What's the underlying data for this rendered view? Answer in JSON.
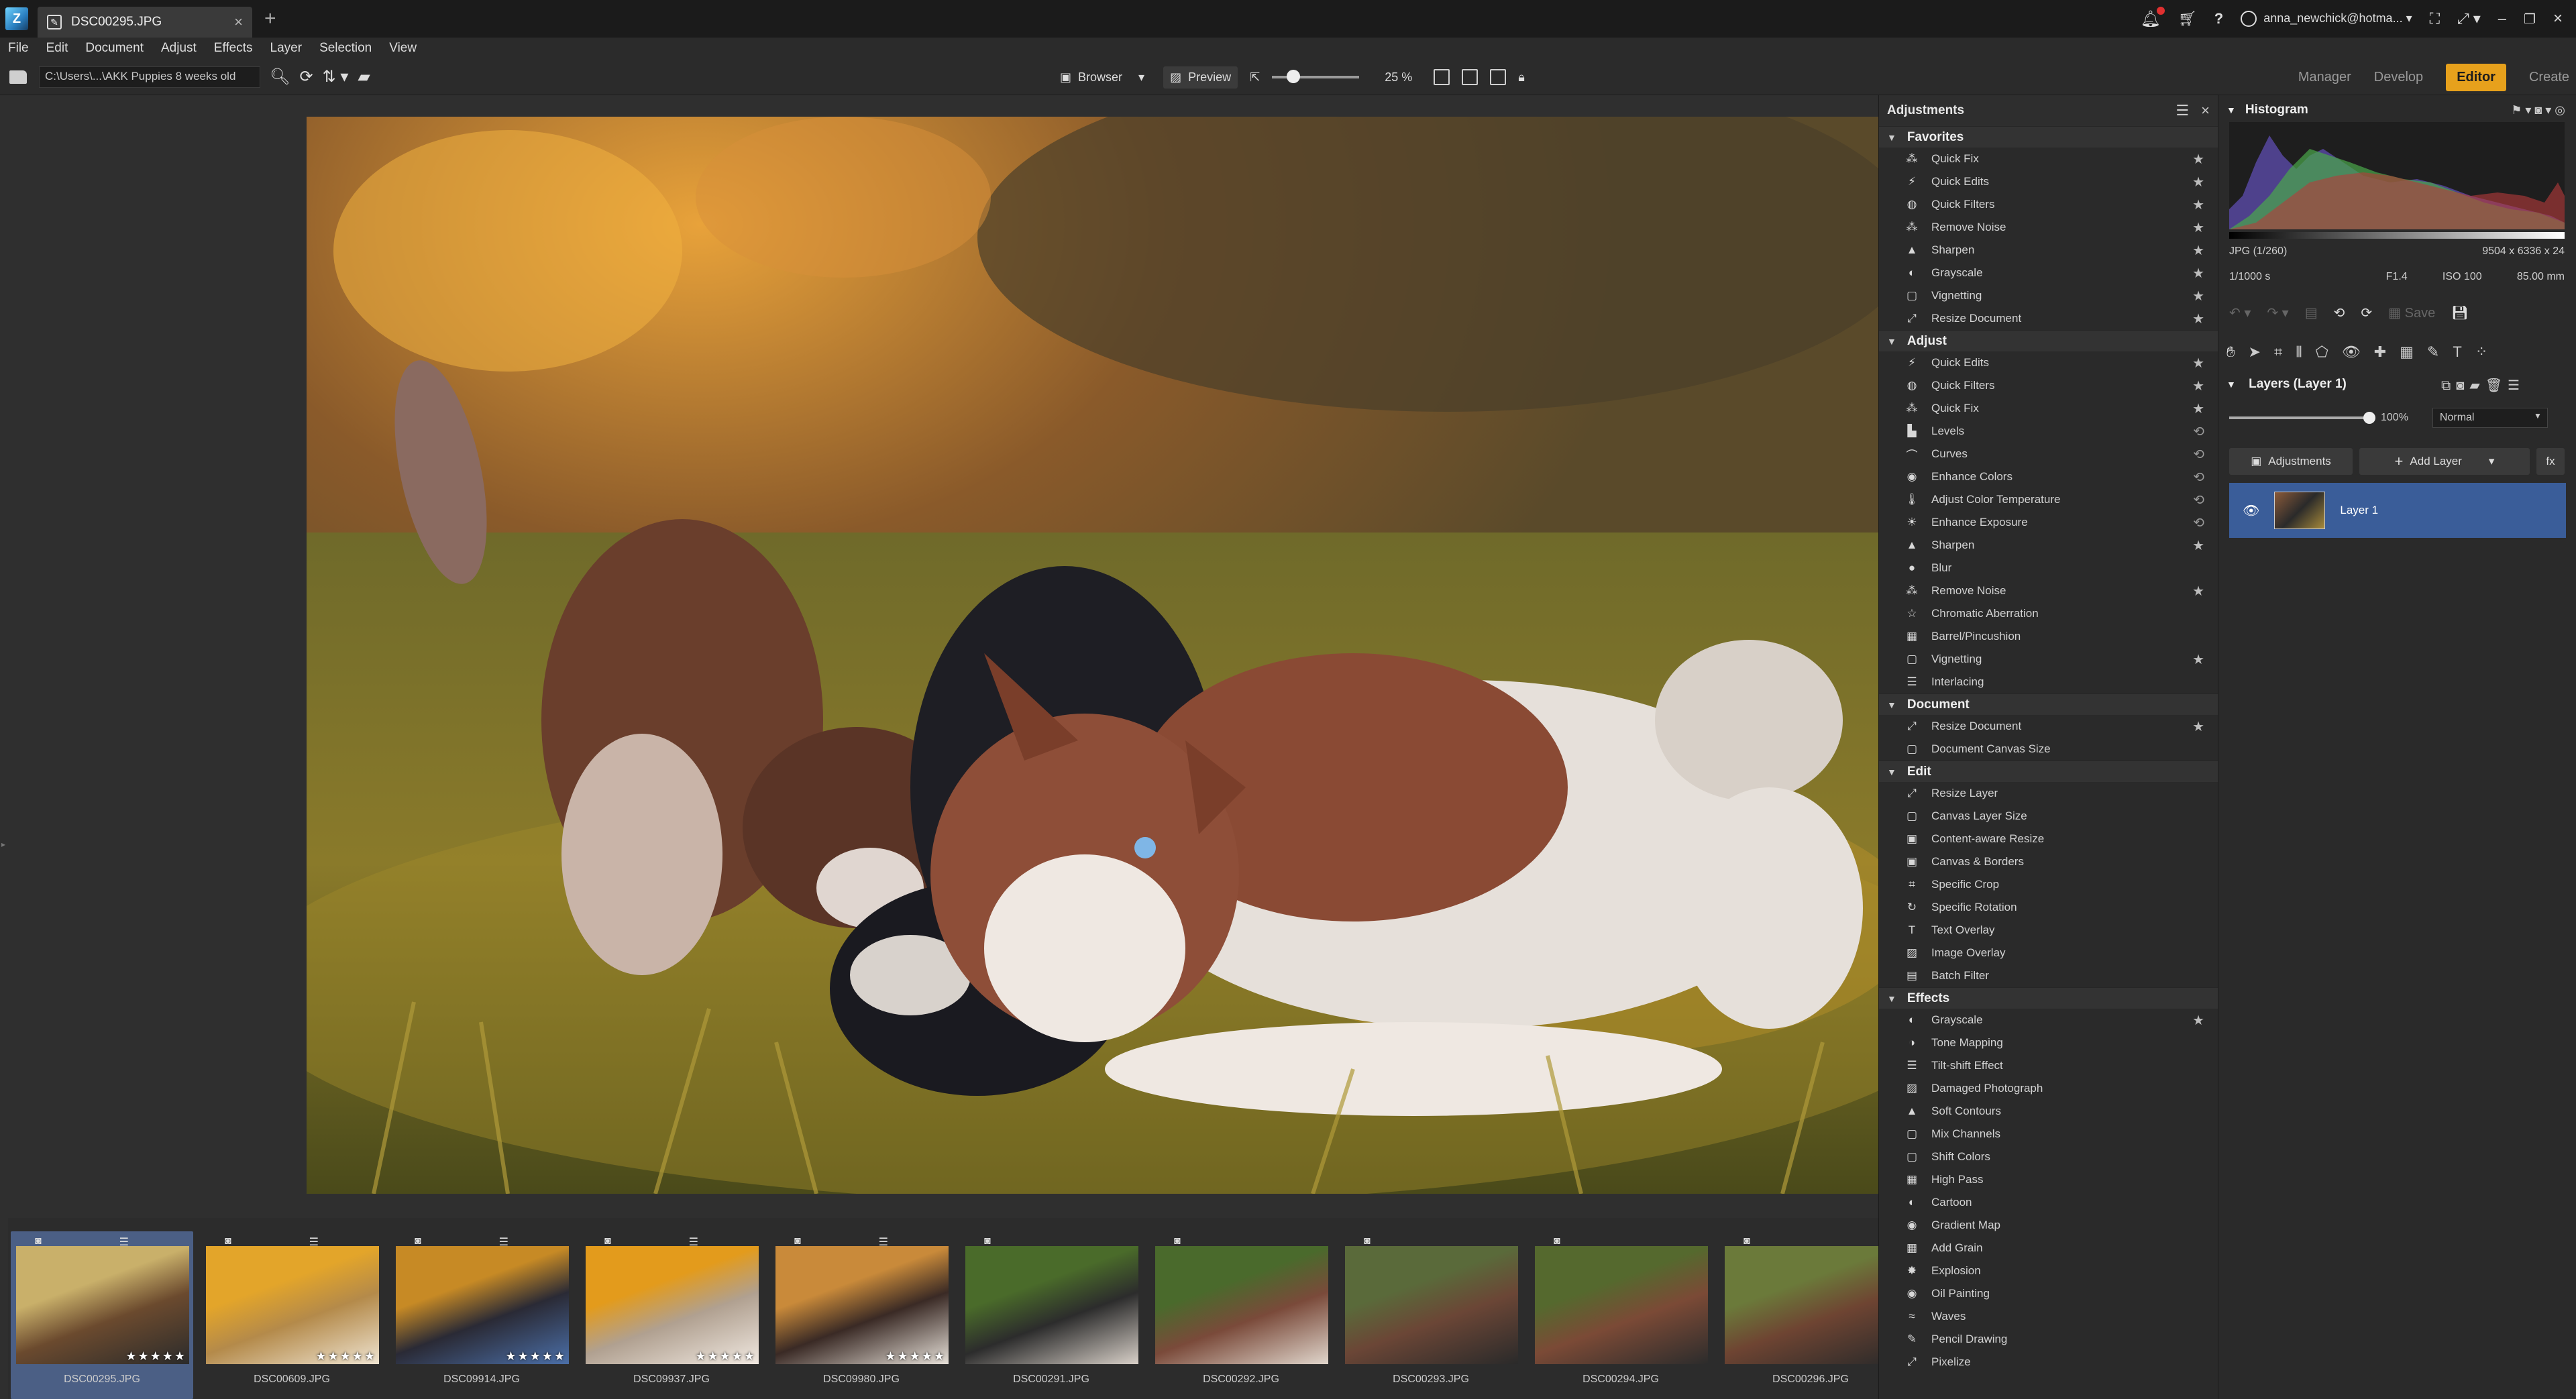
{
  "window": {
    "tab_title": "DSC00295.JPG",
    "new_tab": "+",
    "user": "anna_newchick@hotma..."
  },
  "menu": [
    "File",
    "Edit",
    "Document",
    "Adjust",
    "Effects",
    "Layer",
    "Selection",
    "View"
  ],
  "toolbar": {
    "path": "C:\\Users\\...\\AKK Puppies 8 weeks old",
    "browser_label": "Browser",
    "preview_label": "Preview",
    "zoom": "25 %",
    "zoom_level": 0.2
  },
  "modes": {
    "manager": "Manager",
    "develop": "Develop",
    "editor": "Editor",
    "create": "Create",
    "active": "Editor"
  },
  "adjustments": {
    "title": "Adjustments",
    "sections": [
      {
        "name": "Favorites",
        "items": [
          {
            "label": "Quick Fix",
            "icon": "wand-icon",
            "marker": "star"
          },
          {
            "label": "Quick Edits",
            "icon": "bolt-icon",
            "marker": "star"
          },
          {
            "label": "Quick Filters",
            "icon": "filter-icon",
            "marker": "star"
          },
          {
            "label": "Remove Noise",
            "icon": "wand-icon",
            "marker": "star"
          },
          {
            "label": "Sharpen",
            "icon": "triangle-icon",
            "marker": "star"
          },
          {
            "label": "Grayscale",
            "icon": "circle-half-icon",
            "marker": "star"
          },
          {
            "label": "Vignetting",
            "icon": "square-icon",
            "marker": "star"
          },
          {
            "label": "Resize Document",
            "icon": "resize-icon",
            "marker": "star"
          }
        ]
      },
      {
        "name": "Adjust",
        "items": [
          {
            "label": "Quick Edits",
            "icon": "bolt-icon",
            "marker": "star"
          },
          {
            "label": "Quick Filters",
            "icon": "filter-icon",
            "marker": "star"
          },
          {
            "label": "Quick Fix",
            "icon": "wand-icon",
            "marker": "star"
          },
          {
            "label": "Levels",
            "icon": "levels-icon",
            "marker": "history"
          },
          {
            "label": "Curves",
            "icon": "curve-icon",
            "marker": "history"
          },
          {
            "label": "Enhance Colors",
            "icon": "palette-icon",
            "marker": "history"
          },
          {
            "label": "Adjust Color Temperature",
            "icon": "thermometer-icon",
            "marker": "history"
          },
          {
            "label": "Enhance Exposure",
            "icon": "sun-icon",
            "marker": "history"
          },
          {
            "label": "Sharpen",
            "icon": "triangle-icon",
            "marker": "star"
          },
          {
            "label": "Blur",
            "icon": "drop-icon",
            "marker": ""
          },
          {
            "label": "Remove Noise",
            "icon": "wand-icon",
            "marker": "star"
          },
          {
            "label": "Chromatic Aberration",
            "icon": "star-outline-icon",
            "marker": ""
          },
          {
            "label": "Barrel/Pincushion",
            "icon": "grid-icon",
            "marker": ""
          },
          {
            "label": "Vignetting",
            "icon": "square-icon",
            "marker": "star"
          },
          {
            "label": "Interlacing",
            "icon": "lines-icon",
            "marker": ""
          }
        ]
      },
      {
        "name": "Document",
        "items": [
          {
            "label": "Resize Document",
            "icon": "resize-icon",
            "marker": "star"
          },
          {
            "label": "Document Canvas Size",
            "icon": "square-icon",
            "marker": ""
          }
        ]
      },
      {
        "name": "Edit",
        "items": [
          {
            "label": "Resize Layer",
            "icon": "resize-icon",
            "marker": ""
          },
          {
            "label": "Canvas Layer Size",
            "icon": "square-icon",
            "marker": ""
          },
          {
            "label": "Content-aware Resize",
            "icon": "square-dot-icon",
            "marker": ""
          },
          {
            "label": "Canvas & Borders",
            "icon": "frame-icon",
            "marker": ""
          },
          {
            "label": "Specific Crop",
            "icon": "crop-icon",
            "marker": ""
          },
          {
            "label": "Specific Rotation",
            "icon": "rotate-icon",
            "marker": ""
          },
          {
            "label": "Text Overlay",
            "icon": "text-icon",
            "marker": ""
          },
          {
            "label": "Image Overlay",
            "icon": "image-icon",
            "marker": ""
          },
          {
            "label": "Batch Filter",
            "icon": "batch-icon",
            "marker": ""
          }
        ]
      },
      {
        "name": "Effects",
        "items": [
          {
            "label": "Grayscale",
            "icon": "circle-half-icon",
            "marker": "star"
          },
          {
            "label": "Tone Mapping",
            "icon": "tone-icon",
            "marker": ""
          },
          {
            "label": "Tilt-shift Effect",
            "icon": "lines-icon",
            "marker": ""
          },
          {
            "label": "Damaged Photograph",
            "icon": "image-icon",
            "marker": ""
          },
          {
            "label": "Soft Contours",
            "icon": "triangle-icon",
            "marker": ""
          },
          {
            "label": "Mix Channels",
            "icon": "square-icon",
            "marker": ""
          },
          {
            "label": "Shift Colors",
            "icon": "square-icon",
            "marker": ""
          },
          {
            "label": "High Pass",
            "icon": "grid-icon",
            "marker": ""
          },
          {
            "label": "Cartoon",
            "icon": "circle-half-icon",
            "marker": ""
          },
          {
            "label": "Gradient Map",
            "icon": "palette-icon",
            "marker": ""
          },
          {
            "label": "Add Grain",
            "icon": "grid-icon",
            "marker": ""
          },
          {
            "label": "Explosion",
            "icon": "burst-icon",
            "marker": ""
          },
          {
            "label": "Oil Painting",
            "icon": "palette-icon",
            "marker": ""
          },
          {
            "label": "Waves",
            "icon": "wave-icon",
            "marker": ""
          },
          {
            "label": "Pencil Drawing",
            "icon": "pencil-icon",
            "marker": ""
          },
          {
            "label": "Pixelize",
            "icon": "resize-icon",
            "marker": ""
          }
        ]
      }
    ]
  },
  "histogram": {
    "title": "Histogram",
    "format": "JPG",
    "index": "(1/260)",
    "dimensions": "9504 x 6336 x 24",
    "shutter": "1/1000 s",
    "aperture": "F1.4",
    "iso": "ISO 100",
    "focal": "85.00 mm"
  },
  "layers": {
    "title": "Layers (Layer 1)",
    "opacity": "100%",
    "blend": "Normal",
    "adjustments_btn": "Adjustments",
    "add_layer_btn": "Add Layer",
    "fx_btn": "fx",
    "items": [
      {
        "name": "Layer 1"
      }
    ]
  },
  "filmstrip": [
    {
      "name": "DSC00295.JPG",
      "stars": "★★★★★",
      "selected": true,
      "palette": [
        "#c9b06a",
        "#6b4a2e",
        "#2b2b2b"
      ]
    },
    {
      "name": "DSC00609.JPG",
      "stars": "★★★★★",
      "selected": false,
      "palette": [
        "#e3a52a",
        "#b48a4a",
        "#eee3d0"
      ]
    },
    {
      "name": "DSC09914.JPG",
      "stars": "★★★★★",
      "selected": false,
      "palette": [
        "#c78a25",
        "#2a2a35",
        "#4b6fa8"
      ]
    },
    {
      "name": "DSC09937.JPG",
      "stars": "★★★★★",
      "selected": false,
      "palette": [
        "#e39b1c",
        "#b0a090",
        "#f0e8e0"
      ]
    },
    {
      "name": "DSC09980.JPG",
      "stars": "★★★★★",
      "selected": false,
      "palette": [
        "#c98a3a",
        "#3a2a25",
        "#e6e0d8"
      ]
    },
    {
      "name": "DSC00291.JPG",
      "stars": "",
      "selected": false,
      "palette": [
        "#4a6b2a",
        "#2c2c2c",
        "#d8d0c8"
      ]
    },
    {
      "name": "DSC00292.JPG",
      "stars": "",
      "selected": false,
      "palette": [
        "#4a6a2c",
        "#7a4a3a",
        "#e0d6cc"
      ]
    },
    {
      "name": "DSC00293.JPG",
      "stars": "",
      "selected": false,
      "palette": [
        "#5a6a3a",
        "#6b4636",
        "#2a2a2a"
      ]
    },
    {
      "name": "DSC00294.JPG",
      "stars": "",
      "selected": false,
      "palette": [
        "#55692e",
        "#7b4a36",
        "#2c2c2c"
      ]
    },
    {
      "name": "DSC00296.JPG",
      "stars": "",
      "selected": false,
      "palette": [
        "#6b7a3a",
        "#6e4432",
        "#2a2a2a"
      ]
    }
  ]
}
